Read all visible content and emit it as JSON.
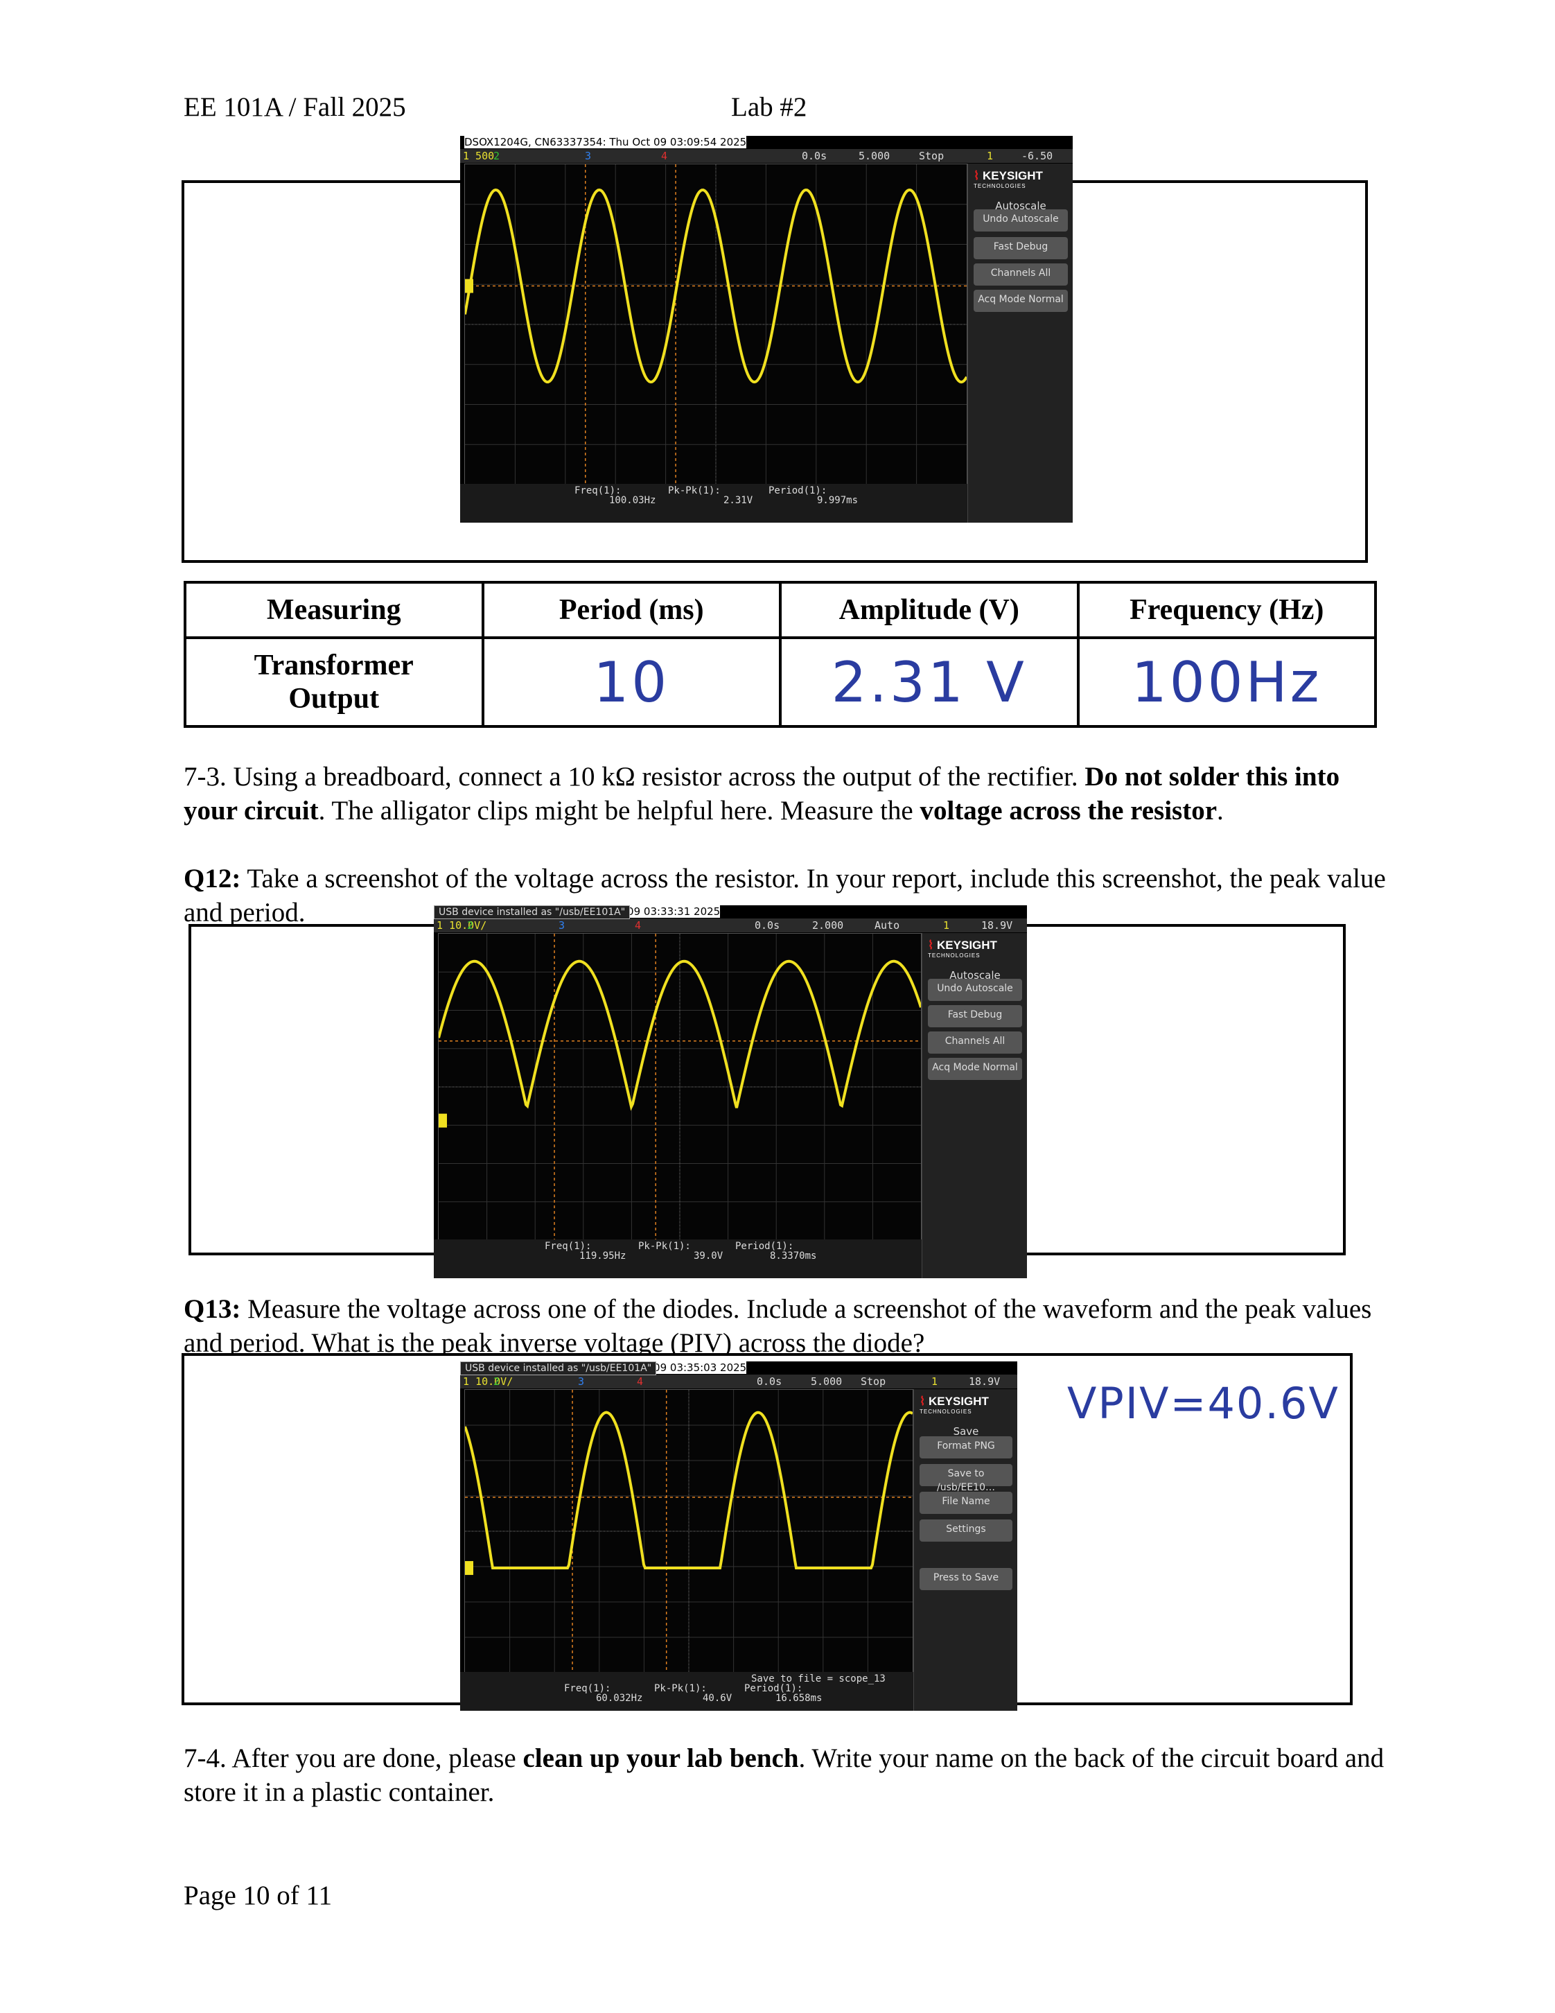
{
  "header": {
    "course": "EE 101A / Fall 2025",
    "lab": "Lab #2"
  },
  "scope1": {
    "meta": "DSOX1204G, CN63337354: Thu Oct 09 03:09:54 2025",
    "ch1": "1  500",
    "ch2": "2",
    "ch3": "3",
    "ch4": "4",
    "time_pos": "0.0s",
    "time_div": "5.000",
    "run_state": "Stop",
    "trig_ch": "1",
    "trig_level": "-6.50",
    "brand": "KEYSIGHT",
    "brand_sub": "TECHNOLOGIES",
    "menu_title": "Autoscale",
    "buttons": [
      "Undo Autoscale",
      "Fast Debug",
      "Channels All",
      "Acq Mode Normal"
    ],
    "freq_label": "Freq(1):",
    "freq_val": "100.03Hz",
    "pkpk_label": "Pk-Pk(1):",
    "pkpk_val": "2.31V",
    "period_label": "Period(1):",
    "period_val": "9.997ms"
  },
  "table": {
    "headers": [
      "Measuring",
      "Period (ms)",
      "Amplitude (V)",
      "Frequency (Hz)"
    ],
    "row_label": "Transformer Output",
    "period": "10",
    "amplitude": "2.31 V",
    "frequency": "100Hz"
  },
  "para_7_3": {
    "t1": "7-3. Using a breadboard, connect a 10 kΩ resistor across the output of the rectifier. ",
    "b1": "Do not solder this into your circuit",
    "t2": ". The alligator clips might be helpful here. Measure the ",
    "b2": "voltage across the resistor",
    "t3": "."
  },
  "q12": {
    "label": "Q12:",
    "text": " Take a screenshot of the voltage across the resistor. In your report, include this screenshot, the peak value and period."
  },
  "scope2": {
    "meta": "DSOX1204G, CN63337354: Thu Oct 09 03:33:31 2025",
    "ch1": "1  10.0V/",
    "ch2": "2",
    "ch3": "3",
    "ch4": "4",
    "time_pos": "0.0s",
    "time_div": "2.000",
    "run_state": "Auto",
    "trig_ch": "1",
    "trig_level": "18.9V",
    "usb_msg": "USB device installed as \"/usb/EE101A\"",
    "brand": "KEYSIGHT",
    "brand_sub": "TECHNOLOGIES",
    "menu_title": "Autoscale",
    "buttons": [
      "Undo Autoscale",
      "Fast Debug",
      "Channels All",
      "Acq Mode Normal"
    ],
    "freq_label": "Freq(1):",
    "freq_val": "119.95Hz",
    "pkpk_label": "Pk-Pk(1):",
    "pkpk_val": "39.0V",
    "period_label": "Period(1):",
    "period_val": "8.3370ms"
  },
  "q13": {
    "label": "Q13:",
    "text": " Measure the voltage across one of the diodes. Include a screenshot of the waveform and the peak values and period. What is the peak inverse voltage (PIV) across the diode?"
  },
  "scope3": {
    "meta": "DSOX1204G, CN63337354: Thu Oct 09 03:35:03 2025",
    "ch1": "1  10.0V/",
    "ch2": "2",
    "ch3": "3",
    "ch4": "4",
    "time_pos": "0.0s",
    "time_div": "5.000",
    "run_state": "Stop",
    "trig_ch": "1",
    "trig_level": "18.9V",
    "usb_msg": "USB device installed as \"/usb/EE101A\"",
    "brand": "KEYSIGHT",
    "brand_sub": "TECHNOLOGIES",
    "menu_title": "Save",
    "buttons": [
      "Format PNG",
      "Save to /usb/EE10…",
      "File Name",
      "Settings",
      "Press to Save"
    ],
    "save_msg": "Save to file = scope_13",
    "freq_label": "Freq(1):",
    "freq_val": "60.032Hz",
    "pkpk_label": "Pk-Pk(1):",
    "pkpk_val": "40.6V",
    "period_label": "Period(1):",
    "period_val": "16.658ms"
  },
  "handnote": "VPIV=40.6V",
  "para_7_4": {
    "t1": "7-4. After you are done, please ",
    "b1": "clean up your lab bench",
    "t2": ". Write your name on the back of the circuit board and store it in a plastic container."
  },
  "footer": "Page 10 of  11",
  "colors": {
    "trace": "#f0e020",
    "trig": "#e08020",
    "keysight_red": "#e02020"
  }
}
